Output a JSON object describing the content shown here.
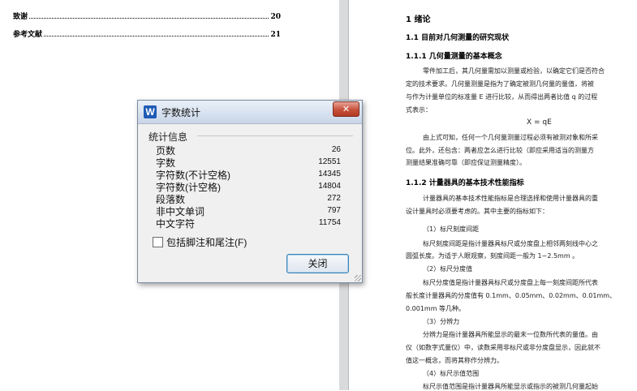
{
  "toc": [
    {
      "label": "致谢",
      "page": "20"
    },
    {
      "label": "参考文献",
      "page": "21"
    }
  ],
  "document": {
    "heading1": "1 绪论",
    "heading1_1": "1.1 目前对几何测量的研究现状",
    "heading1_1_1": "1.1.1 几何量测量的基本概念",
    "para1": [
      "零件加工后，其几何量需加以测量或检验，以确定它们是否符合",
      "定的技术要求。几何量测量是指为了确定被测几何量的量值，将被",
      "与作为计量单位的标准量 E 进行比较，从而得出两者比值 q 的过程",
      "式表示："
    ],
    "formula": "X = qE",
    "para2": [
      "由上式可知，任何一个几何量测量过程必须有被测对象和所采",
      "位。此外，还包含：两者应怎么进行比较（即应采用适当的测量方",
      "测量结果准确可靠（即应保证测量精度）。"
    ],
    "heading1_1_2": "1.1.2 计量器具的基本技术性能指标",
    "para3": [
      "计量器具的基本技术性能指标是合理选择和使用计量器具的重",
      "设计量具时必须要考虑的。其中主要的指标如下："
    ],
    "item1": "（1）标尺刻度间距",
    "para4": [
      "标尺刻度间距是指计量器具标尺或分度盘上相邻两刻线中心之",
      "圆弧长度。为适于人眼观察，刻度间距一般为 1~2.5mm 。"
    ],
    "item2": "（2）标尺分度值",
    "para5": [
      "标尺分度值是指计量器具标尺或分度盘上每一刻度间距所代表",
      "般长度计量器具的分度值有 0.1mm、0.05mm、0.02mm、0.01mm、",
      "0.001mm 等几种。"
    ],
    "item3": "（3）分辨力",
    "para6": [
      "分辨力是指计量器具所能显示的最末一位数所代表的量值。由",
      "仪（如数字式量仪）中，读数采用非标尺或非分度盘显示，因此就不",
      "值这一概念，而将其称作分辨力。"
    ],
    "item4": "（4）标尺示值范围",
    "para7": [
      "标尺示值范围是指计量器具所能显示或指示的被测几何量起始"
    ]
  },
  "dialog": {
    "title": "字数统计",
    "close_glyph": "✕",
    "group_label": "统计信息",
    "stats": [
      {
        "label": "页数",
        "value": "26"
      },
      {
        "label": "字数",
        "value": "12551"
      },
      {
        "label": "字符数(不计空格)",
        "value": "14345"
      },
      {
        "label": "字符数(计空格)",
        "value": "14804"
      },
      {
        "label": "段落数",
        "value": "272"
      },
      {
        "label": "非中文单词",
        "value": "797"
      },
      {
        "label": "中文字符",
        "value": "11754"
      }
    ],
    "checkbox_label": "包括脚注和尾注(F)",
    "checkbox_checked": false,
    "close_button_label": "关闭"
  },
  "colors": {
    "accent": "#1f5bb5",
    "close_red": "#c7503b",
    "page_gap": "#d9dadc"
  }
}
